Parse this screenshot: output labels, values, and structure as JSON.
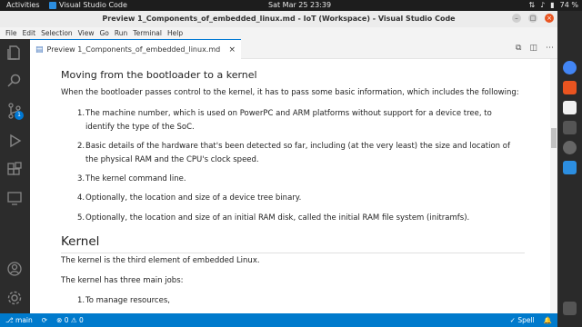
{
  "system_bar": {
    "activities": "Activities",
    "app_name": "Visual Studio Code",
    "clock": "Sat Mar 25  23:39",
    "battery": "74 %"
  },
  "window": {
    "title": "Preview 1_Components_of_embedded_linux.md - IoT (Workspace) - Visual Studio Code"
  },
  "menu": [
    "File",
    "Edit",
    "Selection",
    "View",
    "Go",
    "Run",
    "Terminal",
    "Help"
  ],
  "activity_bar": {
    "source_control_badge": "1"
  },
  "tab": {
    "label": "Preview 1_Components_of_embedded_linux.md"
  },
  "doc": {
    "heading1": "Moving from the bootloader to a kernel",
    "intro": "When the bootloader passes control to the kernel, it has to pass some basic information, which includes the following:",
    "items1": [
      {
        "n": "1.",
        "lines": [
          "The machine number, which is used on PowerPC and ARM platforms without support for a device tree, to",
          "identify the type of the SoC."
        ]
      },
      {
        "n": "2.",
        "lines": [
          "Basic details of the hardware that's been detected so far, including (at the very least) the size and location of",
          "the physical RAM and the CPU's clock speed."
        ]
      },
      {
        "n": "3.",
        "lines": [
          "The kernel command line."
        ]
      },
      {
        "n": "4.",
        "lines": [
          "Optionally, the location and size of a device tree binary."
        ]
      },
      {
        "n": "5.",
        "lines": [
          "Optionally, the location and size of an initial RAM disk, called the initial RAM file system (initramfs)."
        ]
      }
    ],
    "heading2": "Kernel",
    "kernel_p1": "The kernel is the third element of embedded Linux.",
    "kernel_p2": "The kernel has three main jobs:",
    "items2": [
      {
        "n": "1.",
        "text": "To manage resources,"
      }
    ]
  },
  "status_bar": {
    "branch": "main",
    "errors": "0",
    "warnings": "0",
    "spell": "Spell"
  },
  "colors": {
    "accent": "#007acc",
    "activity_bg": "#2c2c2c",
    "ubuntu_orange": "#e95420"
  }
}
